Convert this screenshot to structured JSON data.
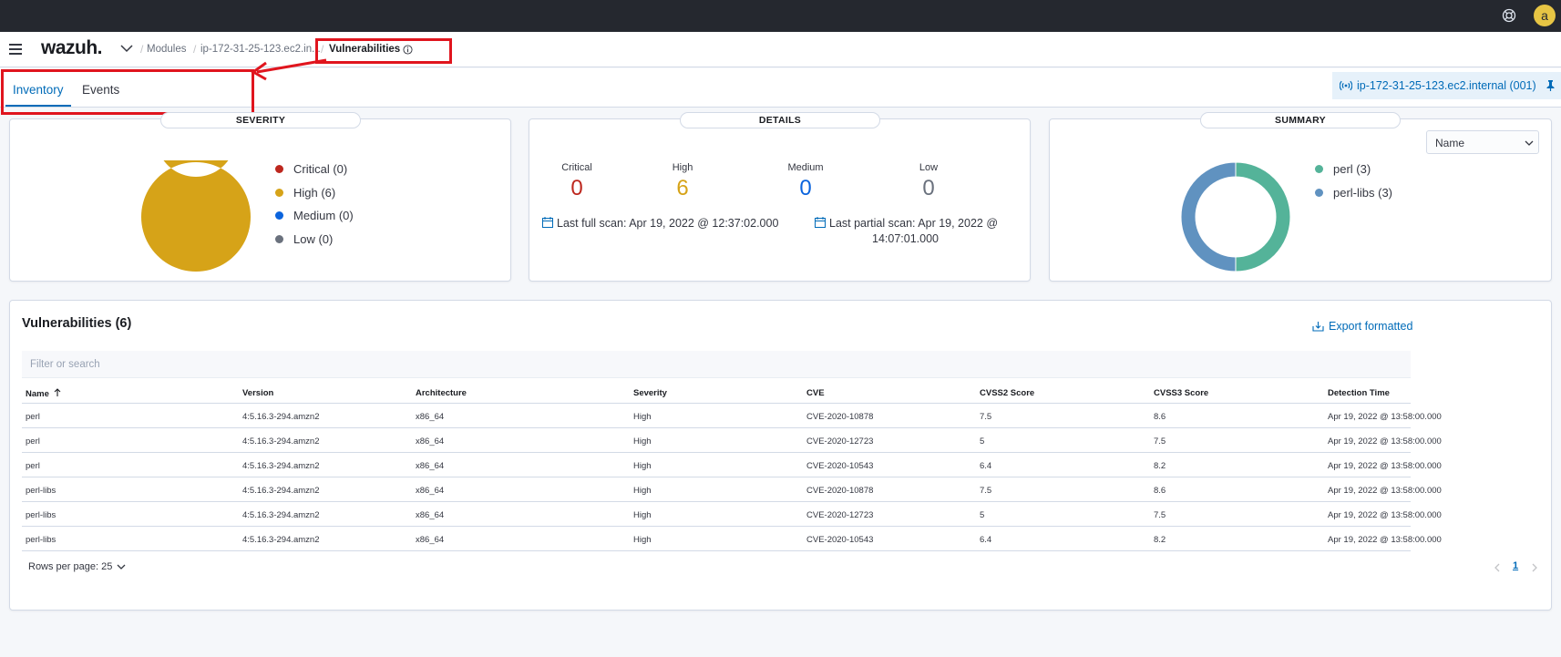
{
  "topbar": {
    "help_icon": "help-lifebuoy-icon",
    "avatar_letter": "a"
  },
  "header": {
    "logo": "wazuh.",
    "breadcrumbs": [
      "Modules",
      "ip-172-31-25-123.ec2.in..."
    ],
    "active_crumb": "Vulnerabilities"
  },
  "tabs": [
    {
      "label": "Inventory",
      "active": true
    },
    {
      "label": "Events",
      "active": false
    }
  ],
  "agent": {
    "label": "ip-172-31-25-123.ec2.internal (001)"
  },
  "severity": {
    "title": "SEVERITY",
    "legend": [
      {
        "label": "Critical (0)",
        "color": "#bd271e"
      },
      {
        "label": "High (6)",
        "color": "#d6a318"
      },
      {
        "label": "Medium (0)",
        "color": "#0b64dd"
      },
      {
        "label": "Low (0)",
        "color": "#6a717d"
      }
    ]
  },
  "details": {
    "title": "DETAILS",
    "counts": [
      {
        "label": "Critical",
        "value": "0",
        "color": "#bd271e"
      },
      {
        "label": "High",
        "value": "6",
        "color": "#d6a318"
      },
      {
        "label": "Medium",
        "value": "0",
        "color": "#0b64dd"
      },
      {
        "label": "Low",
        "value": "0",
        "color": "#6a717d"
      }
    ],
    "last_full_scan": "Last full scan: Apr 19, 2022 @ 12:37:02.000",
    "last_partial_scan_1": "Last partial scan: Apr 19, 2022 @",
    "last_partial_scan_2": "14:07:01.000"
  },
  "summary": {
    "title": "SUMMARY",
    "select_value": "Name",
    "legend": [
      {
        "label": "perl (3)",
        "color": "#54b399"
      },
      {
        "label": "perl-libs (3)",
        "color": "#6092c0"
      }
    ]
  },
  "vulnerabilities": {
    "title": "Vulnerabilities (6)",
    "export_label": "Export formatted",
    "search_placeholder": "Filter or search",
    "columns": [
      "Name",
      "Version",
      "Architecture",
      "Severity",
      "CVE",
      "CVSS2 Score",
      "CVSS3 Score",
      "Detection Time"
    ],
    "rows": [
      [
        "perl",
        "4:5.16.3-294.amzn2",
        "x86_64",
        "High",
        "CVE-2020-10878",
        "7.5",
        "8.6",
        "Apr 19, 2022 @ 13:58:00.000"
      ],
      [
        "perl",
        "4:5.16.3-294.amzn2",
        "x86_64",
        "High",
        "CVE-2020-12723",
        "5",
        "7.5",
        "Apr 19, 2022 @ 13:58:00.000"
      ],
      [
        "perl",
        "4:5.16.3-294.amzn2",
        "x86_64",
        "High",
        "CVE-2020-10543",
        "6.4",
        "8.2",
        "Apr 19, 2022 @ 13:58:00.000"
      ],
      [
        "perl-libs",
        "4:5.16.3-294.amzn2",
        "x86_64",
        "High",
        "CVE-2020-10878",
        "7.5",
        "8.6",
        "Apr 19, 2022 @ 13:58:00.000"
      ],
      [
        "perl-libs",
        "4:5.16.3-294.amzn2",
        "x86_64",
        "High",
        "CVE-2020-12723",
        "5",
        "7.5",
        "Apr 19, 2022 @ 13:58:00.000"
      ],
      [
        "perl-libs",
        "4:5.16.3-294.amzn2",
        "x86_64",
        "High",
        "CVE-2020-10543",
        "6.4",
        "8.2",
        "Apr 19, 2022 @ 13:58:00.000"
      ]
    ],
    "rows_per_page": "Rows per page: 25",
    "current_page": "1"
  },
  "chart_data": [
    {
      "type": "pie",
      "title": "SEVERITY",
      "categories": [
        "Critical",
        "High",
        "Medium",
        "Low"
      ],
      "values": [
        0,
        6,
        0,
        0
      ],
      "colors": [
        "#bd271e",
        "#d6a318",
        "#0b64dd",
        "#6a717d"
      ],
      "donut": true,
      "legend": "right"
    },
    {
      "type": "pie",
      "title": "SUMMARY",
      "categories": [
        "perl",
        "perl-libs"
      ],
      "values": [
        3,
        3
      ],
      "colors": [
        "#54b399",
        "#6092c0"
      ],
      "donut": true,
      "legend": "right"
    }
  ]
}
